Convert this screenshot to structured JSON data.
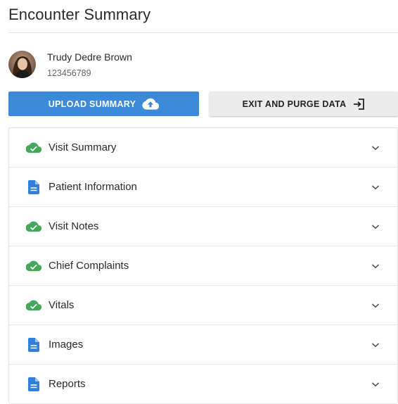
{
  "page": {
    "title": "Encounter Summary"
  },
  "patient": {
    "name": "Trudy Dedre Brown",
    "id": "123456789"
  },
  "actions": {
    "upload_label": "UPLOAD SUMMARY",
    "upload_icon": "cloud-upload-icon",
    "exit_label": "EXIT AND PURGE DATA",
    "exit_icon": "exit-icon"
  },
  "colors": {
    "primary": "#3b8ad8",
    "success": "#43a85a",
    "document": "#2f80d8",
    "secondary_button": "#ececec"
  },
  "sections": [
    {
      "label": "Visit Summary",
      "icon": "cloud-check-icon",
      "status": "complete"
    },
    {
      "label": "Patient Information",
      "icon": "document-icon",
      "status": "document"
    },
    {
      "label": "Visit Notes",
      "icon": "cloud-check-icon",
      "status": "complete"
    },
    {
      "label": "Chief Complaints",
      "icon": "cloud-check-icon",
      "status": "complete"
    },
    {
      "label": "Vitals",
      "icon": "cloud-check-icon",
      "status": "complete"
    },
    {
      "label": "Images",
      "icon": "document-icon",
      "status": "document"
    },
    {
      "label": "Reports",
      "icon": "document-icon",
      "status": "document"
    }
  ]
}
